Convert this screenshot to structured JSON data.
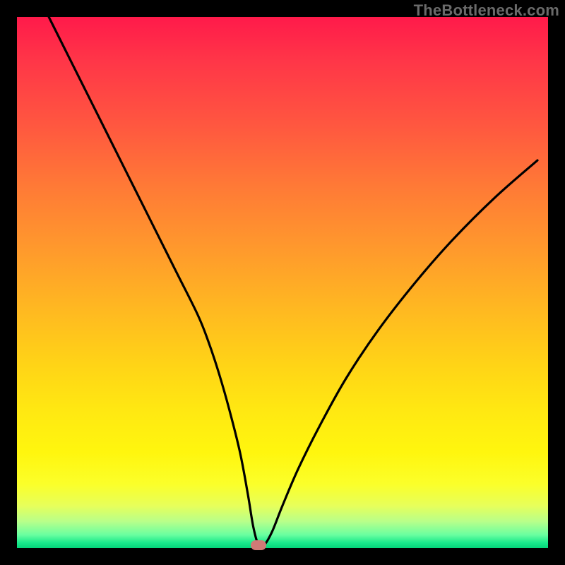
{
  "watermark": {
    "text": "TheBottleneck.com"
  },
  "colors": {
    "frame_bg": "#000000",
    "gradient_top": "#ff1a4a",
    "gradient_bottom": "#04d57a",
    "curve_stroke": "#000000",
    "marker_fill": "#cf7a76",
    "watermark_text": "#6a6a6a"
  },
  "chart_data": {
    "type": "line",
    "title": "",
    "xlabel": "",
    "ylabel": "",
    "xlim": [
      0,
      100
    ],
    "ylim": [
      0,
      100
    ],
    "grid": false,
    "series": [
      {
        "name": "bottleneck-curve",
        "x": [
          6,
          10,
          14,
          18,
          22,
          26,
          30,
          34,
          36,
          38,
          40,
          42,
          43.5,
          44.5,
          45.5,
          46.5,
          48,
          50,
          53,
          57,
          62,
          68,
          75,
          82,
          90,
          98
        ],
        "y": [
          100,
          92,
          84,
          76,
          68,
          60,
          52,
          44,
          39,
          33,
          26,
          18,
          10,
          4,
          0.5,
          0.5,
          3,
          8,
          15,
          23,
          32,
          41,
          50,
          58,
          66,
          73
        ]
      }
    ],
    "marker": {
      "x": 45.5,
      "y": 0.5
    },
    "legend": null,
    "annotations": []
  }
}
